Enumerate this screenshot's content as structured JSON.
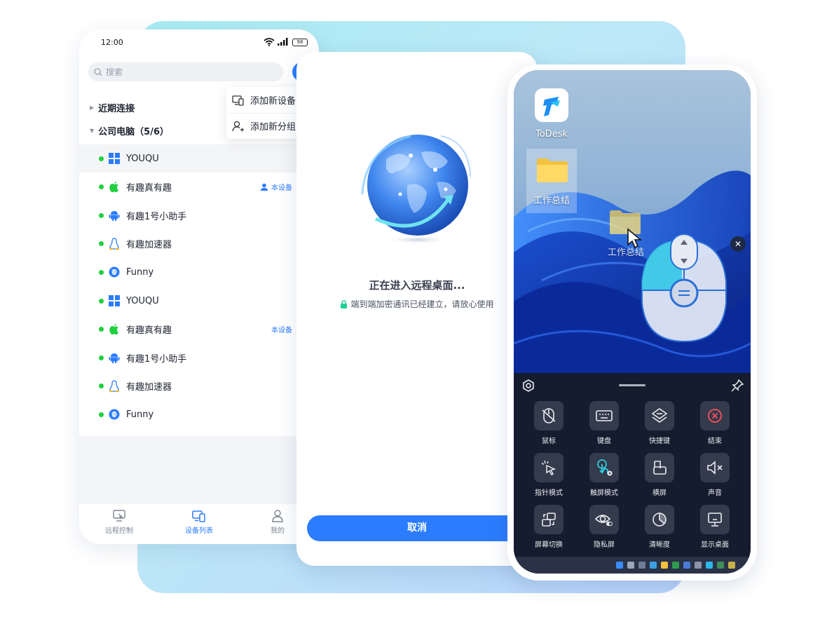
{
  "device_list": {
    "status_time": "12:00",
    "battery": "98",
    "search_placeholder": "搜索",
    "menu": {
      "add_device": "添加新设备",
      "add_group": "添加新分组"
    },
    "groups": [
      {
        "label": "近期连接",
        "expanded": false
      },
      {
        "label": "公司电脑（5/6）",
        "expanded": true
      }
    ],
    "devices": [
      {
        "name": "YOUQU",
        "os": "windows",
        "online": true,
        "selected": true,
        "badge": ""
      },
      {
        "name": "有趣真有趣",
        "os": "apple",
        "online": true,
        "selected": false,
        "badge": "本设备"
      },
      {
        "name": "有趣1号小助手",
        "os": "android",
        "online": true,
        "selected": false,
        "badge": ""
      },
      {
        "name": "有趣加速器",
        "os": "linux",
        "online": true,
        "selected": false,
        "badge": ""
      },
      {
        "name": "Funny",
        "os": "chrome-os",
        "online": true,
        "selected": false,
        "badge": ""
      },
      {
        "name": "YOUQU",
        "os": "windows",
        "online": true,
        "selected": false,
        "badge": ""
      },
      {
        "name": "有趣真有趣",
        "os": "apple",
        "online": true,
        "selected": false,
        "badge": "本设备"
      },
      {
        "name": "有趣1号小助手",
        "os": "android",
        "online": true,
        "selected": false,
        "badge": ""
      },
      {
        "name": "有趣加速器",
        "os": "linux",
        "online": true,
        "selected": false,
        "badge": ""
      },
      {
        "name": "Funny",
        "os": "chrome-os",
        "online": true,
        "selected": false,
        "badge": ""
      }
    ],
    "tabs": [
      {
        "label": "远程控制",
        "active": false
      },
      {
        "label": "设备列表",
        "active": true
      },
      {
        "label": "我的",
        "active": false
      }
    ]
  },
  "connecting": {
    "title": "正在进入远程桌面...",
    "subtitle": "端到端加密通讯已经建立，请放心使用",
    "cancel_label": "取消"
  },
  "remote": {
    "desktop_icons": {
      "app": "ToDesk",
      "folder": "工作总结",
      "dragged_folder": "工作总结"
    },
    "tools": [
      {
        "label": "鼠标",
        "icon": "mouse-icon"
      },
      {
        "label": "键盘",
        "icon": "keyboard-icon"
      },
      {
        "label": "快捷键",
        "icon": "shortcut-icon"
      },
      {
        "label": "结束",
        "icon": "end-icon"
      },
      {
        "label": "指针模式",
        "icon": "pointer-mode-icon"
      },
      {
        "label": "触屏模式",
        "icon": "touch-mode-icon"
      },
      {
        "label": "横屏",
        "icon": "landscape-icon"
      },
      {
        "label": "声音",
        "icon": "sound-muted-icon"
      },
      {
        "label": "屏幕切换",
        "icon": "screen-switch-icon"
      },
      {
        "label": "隐私屏",
        "icon": "privacy-screen-icon"
      },
      {
        "label": "清晰度",
        "icon": "quality-icon"
      },
      {
        "label": "显示桌面",
        "icon": "show-desktop-icon"
      }
    ]
  },
  "colors": {
    "brand": "#2b7cff",
    "online": "#1fcf3f",
    "end": "#ff4d5e"
  }
}
